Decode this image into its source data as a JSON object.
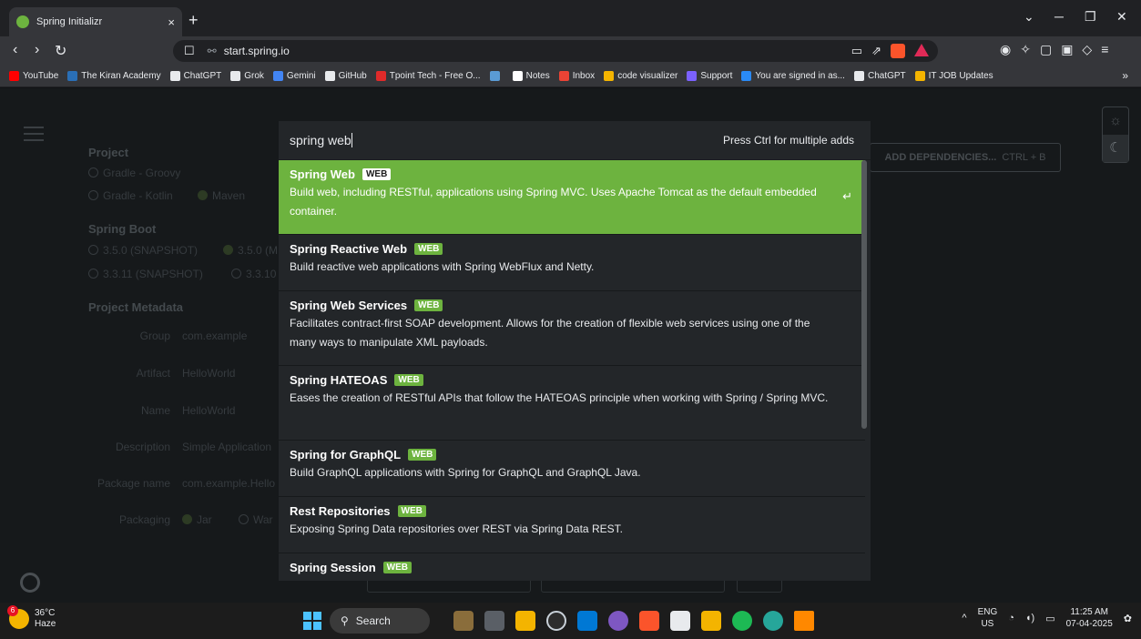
{
  "browser": {
    "tab_title": "Spring Initializr",
    "tab_close": "×",
    "new_tab": "+",
    "url": "start.spring.io",
    "bookmarks": [
      {
        "label": "YouTube",
        "color": "#ff0000"
      },
      {
        "label": "The Kiran Academy",
        "color": "#2a6fb6"
      },
      {
        "label": "ChatGPT",
        "color": "#e8eaed"
      },
      {
        "label": "Grok",
        "color": "#e8eaed"
      },
      {
        "label": "Gemini",
        "color": "#4285f4"
      },
      {
        "label": "GitHub",
        "color": "#e8eaed"
      },
      {
        "label": "Tpoint Tech - Free O...",
        "color": "#e02a2a"
      },
      {
        "label": "",
        "color": "#5a9bd5"
      },
      {
        "label": "Notes",
        "color": "#ffffff"
      },
      {
        "label": "Inbox",
        "color": "#ea4335"
      },
      {
        "label": "code visualizer",
        "color": "#f4b400"
      },
      {
        "label": "Support",
        "color": "#7b61ff"
      },
      {
        "label": "You are signed in as...",
        "color": "#2a8af6"
      },
      {
        "label": "ChatGPT",
        "color": "#e8eaed"
      },
      {
        "label": "IT JOB Updates",
        "color": "#f4b400"
      }
    ]
  },
  "page": {
    "project_title": "Project",
    "project_options": [
      "Gradle - Groovy",
      "Gradle - Kotlin",
      "Maven"
    ],
    "boot_title": "Spring Boot",
    "boot_options": [
      "3.5.0 (SNAPSHOT)",
      "3.5.0 (M",
      "3.3.11 (SNAPSHOT)",
      "3.3.10"
    ],
    "metadata_title": "Project Metadata",
    "metadata": [
      {
        "label": "Group",
        "value": "com.example"
      },
      {
        "label": "Artifact",
        "value": "HelloWorld"
      },
      {
        "label": "Name",
        "value": "HelloWorld"
      },
      {
        "label": "Description",
        "value": "Simple Application"
      },
      {
        "label": "Package name",
        "value": "com.example.Hello"
      }
    ],
    "packaging_label": "Packaging",
    "packaging_options": [
      "Jar",
      "War"
    ],
    "add_dependencies": "ADD DEPENDENCIES...",
    "add_dependencies_kbd": "CTRL + B"
  },
  "dialog": {
    "query": "spring web",
    "hint": "Press Ctrl for multiple adds",
    "results": [
      {
        "name": "Spring Web",
        "tag": "WEB",
        "desc": "Build web, including RESTful, applications using Spring MVC. Uses Apache Tomcat as the default embedded container.",
        "active": true
      },
      {
        "name": "Spring Reactive Web",
        "tag": "WEB",
        "desc": "Build reactive web applications with Spring WebFlux and Netty."
      },
      {
        "name": "Spring Web Services",
        "tag": "WEB",
        "desc": "Facilitates contract-first SOAP development. Allows for the creation of flexible web services using one of the many ways to manipulate XML payloads."
      },
      {
        "name": "Spring HATEOAS",
        "tag": "WEB",
        "desc": "Eases the creation of RESTful APIs that follow the HATEOAS principle when working with Spring / Spring MVC."
      },
      {
        "name": "Spring for GraphQL",
        "tag": "WEB",
        "desc": "Build GraphQL applications with Spring for GraphQL and GraphQL Java."
      },
      {
        "name": "Rest Repositories",
        "tag": "WEB",
        "desc": "Exposing Spring Data repositories over REST via Spring Data REST."
      },
      {
        "name": "Spring Session",
        "tag": "WEB",
        "desc": ""
      }
    ]
  },
  "taskbar": {
    "weather_temp": "36°C",
    "weather_desc": "Haze",
    "weather_badge": "6",
    "search": "Search",
    "lang_top": "ENG",
    "lang_bottom": "US",
    "time": "11:25 AM",
    "date": "07-04-2025"
  }
}
